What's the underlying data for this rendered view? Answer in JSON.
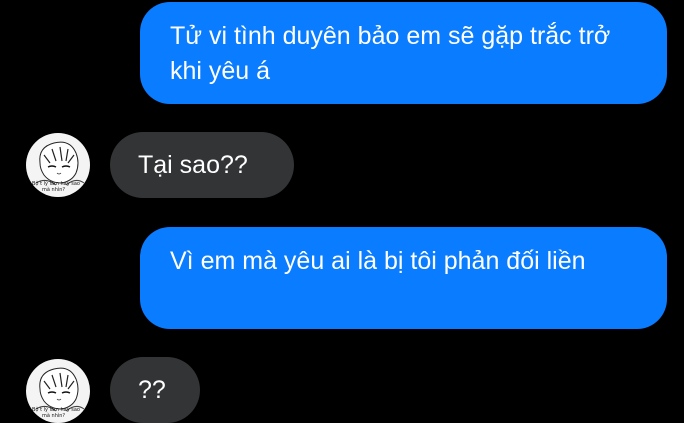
{
  "conversation": {
    "messages": [
      {
        "sender": "me",
        "text": "Tử vi tình duyên bảo em sẽ gặp trắc trở khi yêu á"
      },
      {
        "sender": "other",
        "text": "Tại sao??"
      },
      {
        "sender": "me",
        "text": "Vì em mà yêu ai là bị tôi phản đối liền"
      },
      {
        "sender": "other",
        "text": "??"
      }
    ]
  },
  "avatar": {
    "icon": "anime-boy-avatar-icon",
    "caption_line1": "Bộ t lỳ làm hay sao",
    "caption_line2": "mà nhìn?"
  },
  "colors": {
    "background": "#000000",
    "outgoing_bubble": "#0a7cff",
    "incoming_bubble": "#333436",
    "text": "#ffffff"
  }
}
